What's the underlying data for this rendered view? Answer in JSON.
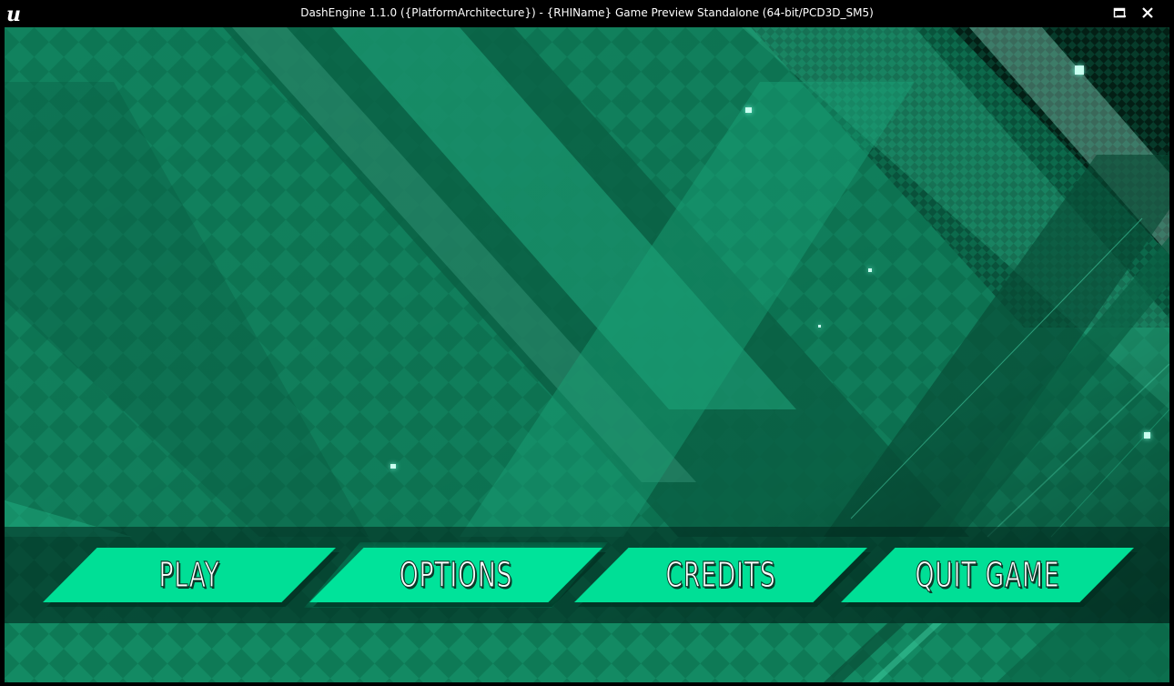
{
  "window": {
    "title": "DashEngine 1.1.0 ({PlatformArchitecture}) - {RHIName} Game Preview Standalone (64-bit/PCD3D_SM5)",
    "controls": [
      "minimize-icon",
      "maximize-icon",
      "close-icon"
    ]
  },
  "menu": {
    "play_label": "PLAY",
    "options_label": "OPTIONS",
    "credits_label": "CREDITS",
    "quit_label": "QUIT GAME"
  },
  "colors": {
    "button": "#00df96",
    "background_dark": "#0b6b4e",
    "background_light": "#1fb889",
    "menubar": "#00231a"
  }
}
